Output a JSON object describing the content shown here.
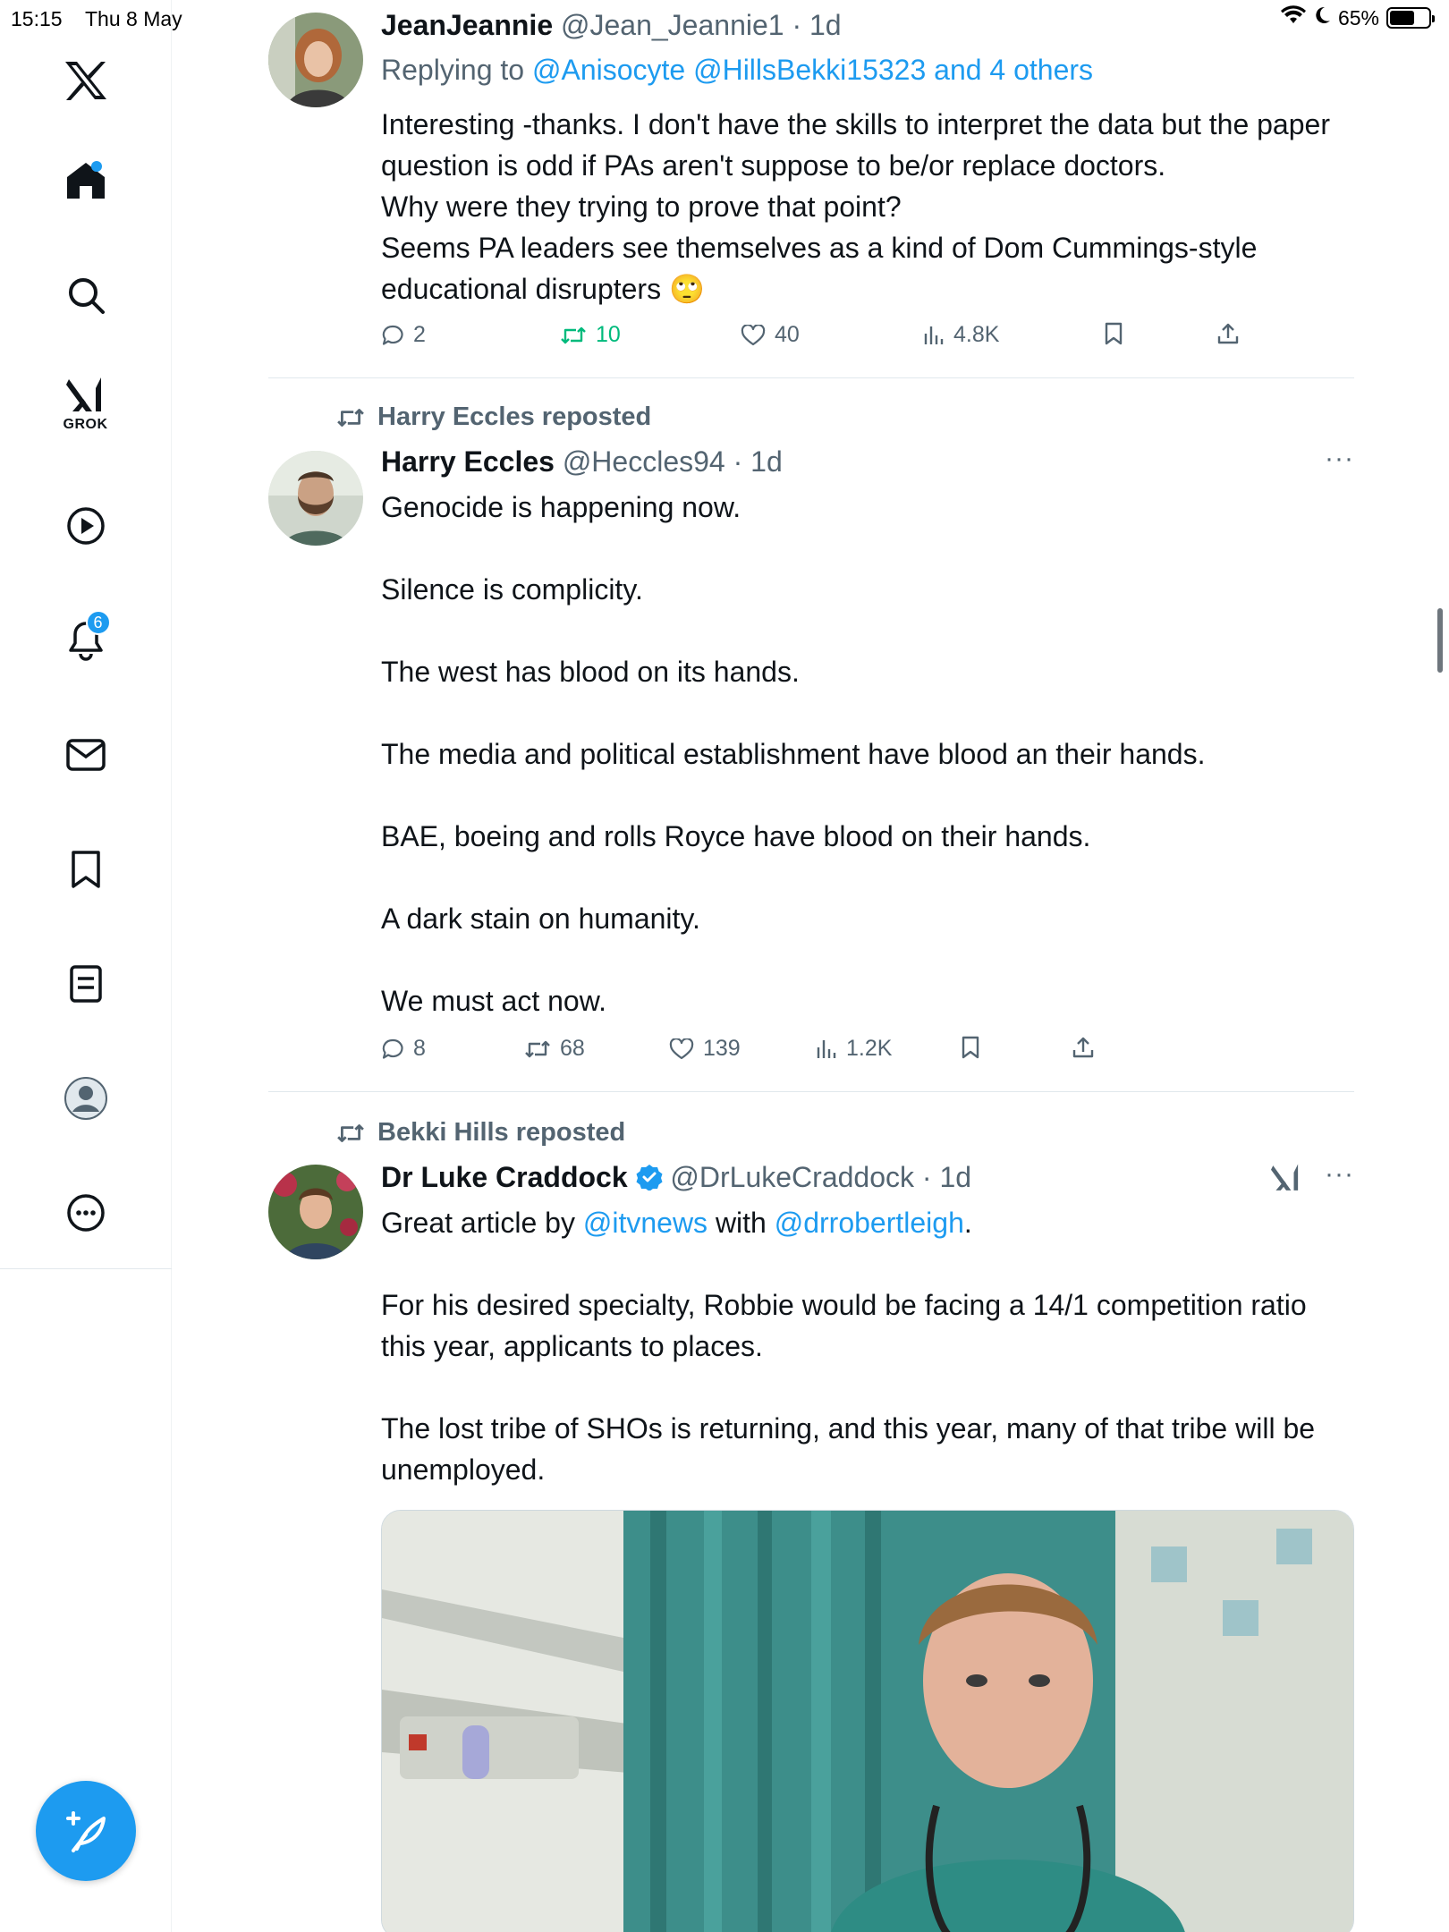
{
  "status_bar": {
    "time": "15:15",
    "date": "Thu 8 May",
    "battery": "65%",
    "battery_level": 0.65
  },
  "sidebar": {
    "grok_label": "GROK",
    "notifications_count": "6"
  },
  "tweets": [
    {
      "name": "JeanJeannie",
      "handle": "@Jean_Jeannie1",
      "time": "1d",
      "replying_prefix": "Replying to ",
      "replying_to": "@Anisocyte @HillsBekki15323 and 4 others",
      "body_lines": [
        "Interesting -thanks. I don't have the skills to interpret the data but the paper question is odd if PAs aren't suppose to be/or replace doctors.",
        "Why were they trying to prove that point?",
        "Seems PA leaders see themselves as a kind of Dom Cummings-style educational disrupters 🙄"
      ],
      "stats": {
        "replies": "2",
        "reposts": "10",
        "likes": "40",
        "views": "4.8K"
      }
    },
    {
      "reposted_by": "Harry Eccles reposted",
      "name": "Harry Eccles",
      "handle": "@Heccles94",
      "time": "1d",
      "body_lines": [
        "Genocide is happening now.",
        "",
        "Silence is complicity.",
        "",
        "The west has blood on its hands.",
        "",
        "The media and political establishment have blood an their hands.",
        "",
        "BAE, boeing and rolls Royce have blood on their hands.",
        "",
        "A dark stain on humanity.",
        "",
        "We must act now."
      ],
      "stats": {
        "replies": "8",
        "reposts": "68",
        "likes": "139",
        "views": "1.2K"
      }
    },
    {
      "reposted_by": "Bekki Hills reposted",
      "name": "Dr Luke Craddock",
      "handle": "@DrLukeCraddock",
      "time": "1d",
      "body_intro": {
        "prefix": "Great article by ",
        "mention1": "@itvnews",
        "middle": " with ",
        "mention2": "@drrobertleigh",
        "suffix": "."
      },
      "body_lines": [
        "For his desired specialty, Robbie would be facing a 14/1 competition ratio this year, applicants to places.",
        "",
        "The lost tribe of SHOs is returning, and this year, many of that tribe will be unemployed."
      ]
    }
  ],
  "colors": {
    "accent": "#1d9bf0",
    "repost_green": "#00ba7c",
    "muted": "#536471"
  }
}
